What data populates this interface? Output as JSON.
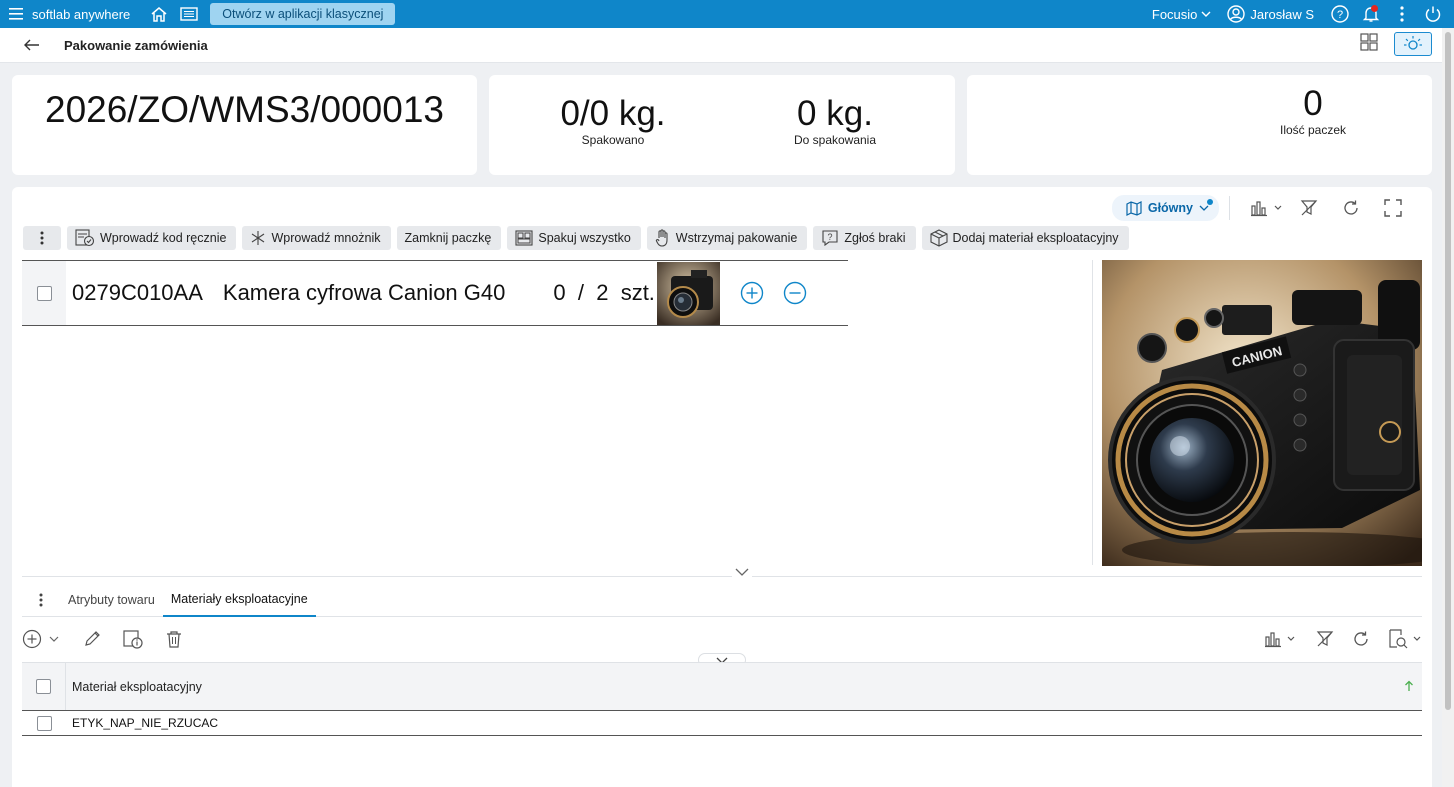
{
  "topbar": {
    "brand": "softlab anywhere",
    "open_classic": "Otwórz w aplikacji klasycznej",
    "company": "Focusio",
    "user": "Jarosław S"
  },
  "header": {
    "title": "Pakowanie zamówienia"
  },
  "summary": {
    "order_number": "2026/ZO/WMS3/000013",
    "packed_value": "0/0 kg.",
    "packed_label": "Spakowano",
    "to_pack_value": "0 kg.",
    "to_pack_label": "Do spakowania",
    "packages_value": "0",
    "packages_label": "Ilość paczek"
  },
  "view": {
    "name": "Główny"
  },
  "actions": [
    {
      "label": "Wprowadź kod ręcznie",
      "icon": "keyboard-check-icon"
    },
    {
      "label": "Wprowadź mnożnik",
      "icon": "asterisk-icon"
    },
    {
      "label": "Zamknij paczkę",
      "icon": ""
    },
    {
      "label": "Spakuj wszystko",
      "icon": "pack-all-icon"
    },
    {
      "label": "Wstrzymaj pakowanie",
      "icon": "hand-icon"
    },
    {
      "label": "Zgłoś braki",
      "icon": "question-icon"
    },
    {
      "label": "Dodaj materiał eksploatacyjny",
      "icon": "box-icon"
    }
  ],
  "item": {
    "code": "0279C010AA",
    "name": "Kamera cyfrowa Canion G40",
    "packed_qty": "0",
    "separator": "/",
    "total_qty": "2",
    "unit": "szt.",
    "brand_on_image": "CANION"
  },
  "tabs": [
    {
      "label": "Atrybuty towaru",
      "active": false
    },
    {
      "label": "Materiały eksploatacyjne",
      "active": true
    }
  ],
  "grid": {
    "column": "Materiał eksploatacyjny",
    "rows": [
      "ETYK_NAP_NIE_RZUCAC"
    ]
  },
  "colors": {
    "topbar": "#0f86c9",
    "accent": "#0f86c9",
    "notification": "#e5261f"
  }
}
